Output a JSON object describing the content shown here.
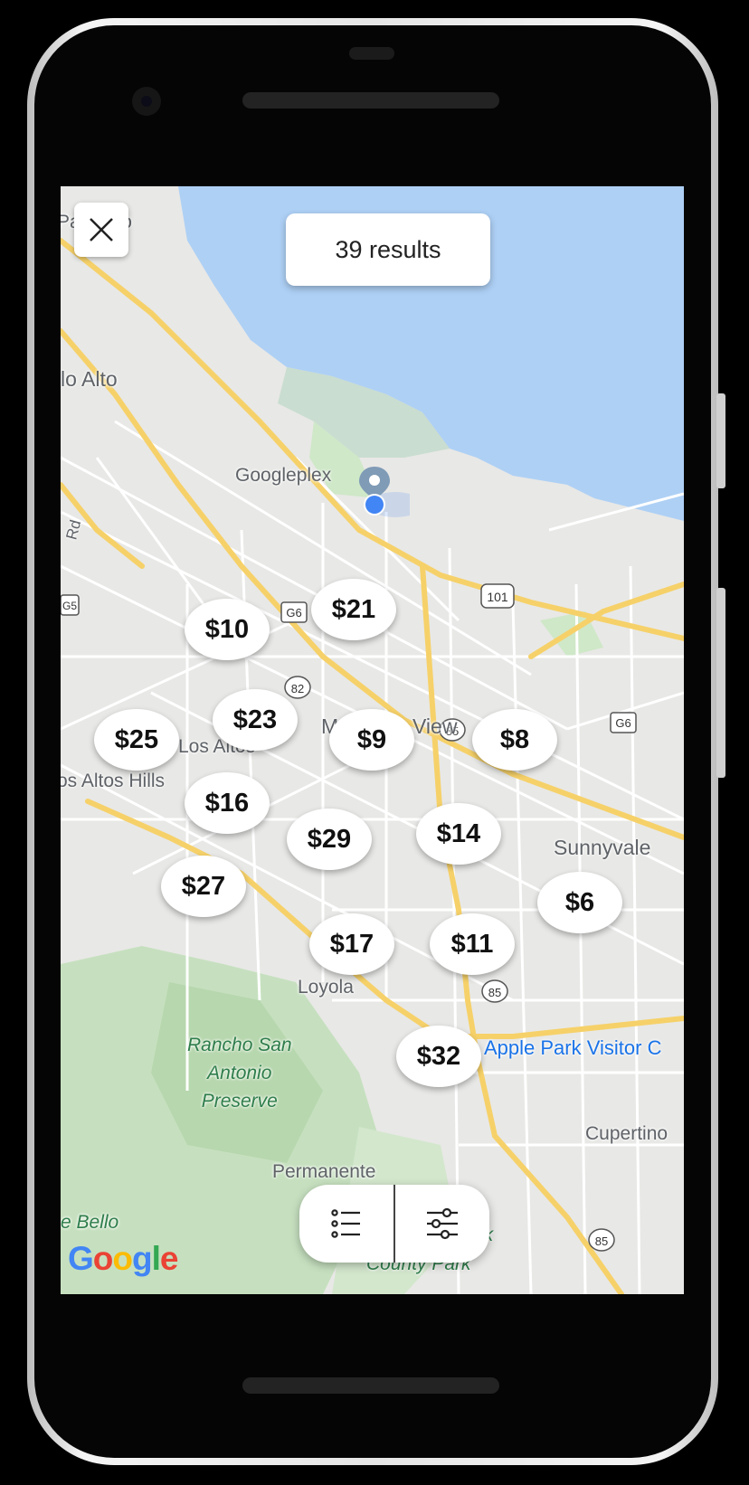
{
  "map": {
    "results_label": "39 results",
    "labels": {
      "palo_alto_top": "Palo Alto",
      "palo_alto": "lo Alto",
      "googleplex": "Googleplex",
      "rd": "Rd",
      "mountain_view": "Mountain View",
      "los_altos": "Los Altos",
      "los_altos_hills": "os Altos Hills",
      "sunnyvale": "Sunnyvale",
      "loyola": "Loyola",
      "rancho": "Rancho San\nAntonio\nPreserve",
      "apple_park": "Apple Park Visitor C",
      "cupertino": "Cupertino",
      "permanente": "Permanente",
      "bello": "e Bello",
      "county_park": "County Park",
      "park_k": "ek"
    },
    "shields": {
      "us101": "101",
      "g6": "G6",
      "g5": "G5",
      "r82": "82",
      "r85": "85"
    },
    "price_markers": [
      {
        "label": "$21"
      },
      {
        "label": "$10"
      },
      {
        "label": "$23"
      },
      {
        "label": "$25"
      },
      {
        "label": "$9"
      },
      {
        "label": "$8"
      },
      {
        "label": "$16"
      },
      {
        "label": "$29"
      },
      {
        "label": "$14"
      },
      {
        "label": "$27"
      },
      {
        "label": "$6"
      },
      {
        "label": "$17"
      },
      {
        "label": "$11"
      },
      {
        "label": "$32"
      }
    ],
    "attribution": "Google"
  },
  "icons": {
    "close": "close-icon",
    "list": "list-icon",
    "filter": "filter-sliders-icon",
    "location": "location-pin-icon"
  },
  "colors": {
    "water": "#aed0f5",
    "land": "#e8e8e6",
    "park": "#cfe8c8",
    "highway": "#f6d169",
    "road": "#ffffff",
    "user_dot": "#4285f4"
  }
}
